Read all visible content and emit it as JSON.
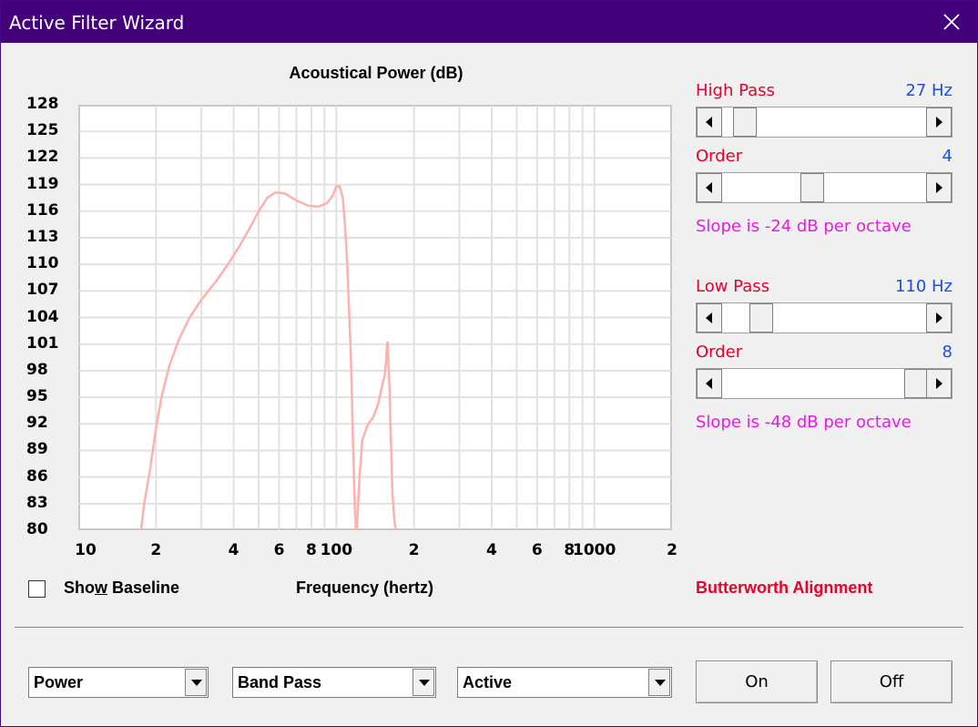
{
  "window": {
    "title": "Active Filter Wizard"
  },
  "chart_data": {
    "type": "line",
    "title": "Acoustical Power (dB)",
    "xlabel": "Frequency (hertz)",
    "ylabel": "",
    "x_scale": "log",
    "xlim": [
      10,
      2000
    ],
    "ylim": [
      80,
      128
    ],
    "yticks": [
      "128",
      "125",
      "122",
      "119",
      "116",
      "113",
      "110",
      "107",
      "104",
      "101",
      "98",
      "95",
      "92",
      "89",
      "86",
      "83",
      "80"
    ],
    "ytick_values": [
      128,
      125,
      122,
      119,
      116,
      113,
      110,
      107,
      104,
      101,
      98,
      95,
      92,
      89,
      86,
      83,
      80
    ],
    "xticks": [
      "10",
      "2",
      "4",
      "6",
      "8",
      "100",
      "2",
      "4",
      "6",
      "8",
      "1000",
      "2"
    ],
    "xtick_values": [
      10,
      20,
      40,
      60,
      80,
      100,
      200,
      400,
      600,
      800,
      1000,
      2000
    ],
    "grid": true,
    "line_color": "#ffb0b0",
    "series": [
      {
        "x": [
          17.5,
          18,
          19,
          20,
          21,
          22.5,
          24.5,
          27,
          30,
          34,
          38,
          42,
          46,
          50,
          54,
          58,
          63,
          70,
          78,
          85,
          92,
          97,
          100,
          103,
          106,
          108,
          110,
          112,
          114,
          115,
          116,
          117,
          118,
          119,
          120,
          121.5,
          123,
          124.5,
          126,
          129,
          131,
          133,
          135,
          138,
          141,
          145,
          148,
          151,
          154,
          156,
          157,
          158,
          158.5,
          159,
          160,
          161,
          162,
          163.5,
          165,
          168,
          170
        ],
        "y": [
          80,
          83,
          87,
          91.5,
          95,
          98.5,
          101.5,
          104,
          106,
          108,
          110,
          112,
          114,
          116,
          117.5,
          118.1,
          118,
          117.2,
          116.6,
          116.5,
          116.9,
          117.8,
          118.8,
          118.8,
          117.4,
          114.5,
          110.5,
          105,
          99,
          94.5,
          90,
          86,
          82.5,
          80,
          80,
          83,
          86,
          88,
          90.2,
          91,
          91.6,
          92,
          92.3,
          92.6,
          93.2,
          94.2,
          95.3,
          96.5,
          97.5,
          99.2,
          100.8,
          101.2,
          100.5,
          99.2,
          97.5,
          95.5,
          92,
          88,
          84,
          81,
          80
        ]
      }
    ]
  },
  "show_baseline": {
    "label_pre": "Sho",
    "label_u": "w",
    "label_post": " Baseline",
    "checked": false
  },
  "high_pass": {
    "label": "High Pass",
    "value": "27 Hz",
    "order_label": "Order",
    "order": "4",
    "slope": "Slope is -24 dB per octave",
    "freq_fraction": 0.06,
    "order_fraction": 0.43
  },
  "low_pass": {
    "label": "Low Pass",
    "value": "110 Hz",
    "order_label": "Order",
    "order": "8",
    "slope": "Slope is -48 dB per octave",
    "freq_fraction": 0.15,
    "order_fraction": 1.0
  },
  "alignment": "Butterworth Alignment",
  "controls": {
    "mode_select": "Power",
    "filter_select": "Band Pass",
    "type_select": "Active",
    "on_label": "On",
    "off_label": "Off"
  },
  "colors": {
    "title_bar": "#42007a",
    "accent_red": "#e8002a",
    "accent_blue": "#1a4fe0",
    "accent_magenta": "#ea1ae4"
  }
}
